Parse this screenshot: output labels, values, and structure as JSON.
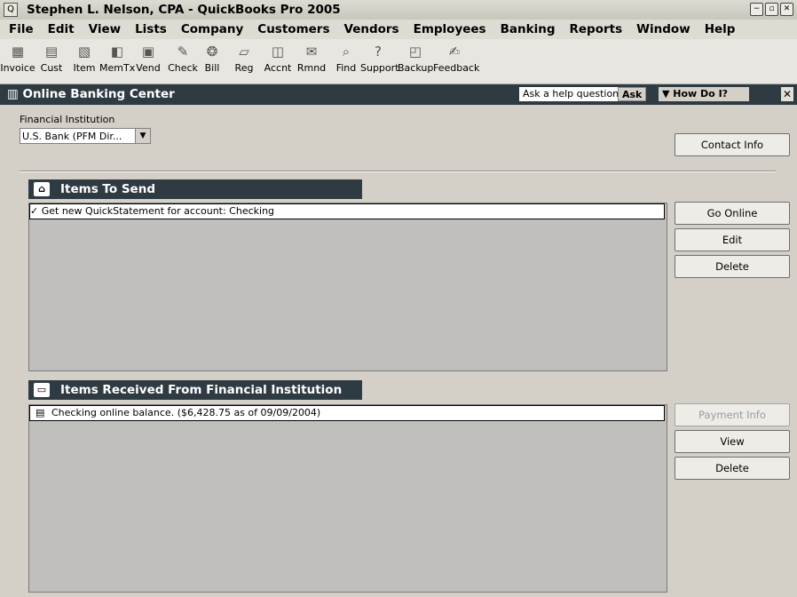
{
  "window": {
    "title": "Stephen L. Nelson, CPA - QuickBooks Pro 2005",
    "controls": [
      "−",
      "▫",
      "✕"
    ]
  },
  "menubar": [
    "File",
    "Edit",
    "View",
    "Lists",
    "Company",
    "Customers",
    "Vendors",
    "Employees",
    "Banking",
    "Reports",
    "Window",
    "Help"
  ],
  "toolbar": [
    {
      "label": "Invoice",
      "icon": "invoice-icon"
    },
    {
      "label": "Cust",
      "icon": "customer-icon"
    },
    {
      "label": "Item",
      "icon": "item-icon"
    },
    {
      "label": "MemTx",
      "icon": "memorized-transactions-icon"
    },
    {
      "label": "Vend",
      "icon": "vendor-icon"
    },
    {
      "label": "Check",
      "icon": "check-icon"
    },
    {
      "label": "Bill",
      "icon": "bill-icon"
    },
    {
      "label": "Reg",
      "icon": "register-icon"
    },
    {
      "label": "Accnt",
      "icon": "accounts-icon"
    },
    {
      "label": "Rmnd",
      "icon": "reminders-icon"
    },
    {
      "label": "Find",
      "icon": "find-icon"
    },
    {
      "label": "Support",
      "icon": "support-icon"
    },
    {
      "label": "Backup",
      "icon": "backup-icon"
    },
    {
      "label": "Feedback",
      "icon": "feedback-icon"
    }
  ],
  "center": {
    "title": "Online Banking Center",
    "ask_placeholder": "Ask a help question",
    "ask_button": "Ask",
    "how_do_i": "How Do I?",
    "close": "✕"
  },
  "financial_institution": {
    "label": "Financial Institution",
    "selected": "U.S. Bank (PFM Dir..."
  },
  "buttons": {
    "contact_info": "Contact Info",
    "go_online": "Go Online",
    "edit": "Edit",
    "delete_send": "Delete",
    "payment_info": "Payment Info",
    "view": "View",
    "delete_received": "Delete"
  },
  "items_to_send": {
    "header": "Items To Send",
    "rows": [
      {
        "check": "✓",
        "text": "Get new QuickStatement for account: Checking"
      }
    ]
  },
  "items_received": {
    "header": "Items Received From Financial Institution",
    "rows": [
      {
        "text": "Checking online balance.  ($6,428.75 as of 09/09/2004)"
      }
    ]
  }
}
